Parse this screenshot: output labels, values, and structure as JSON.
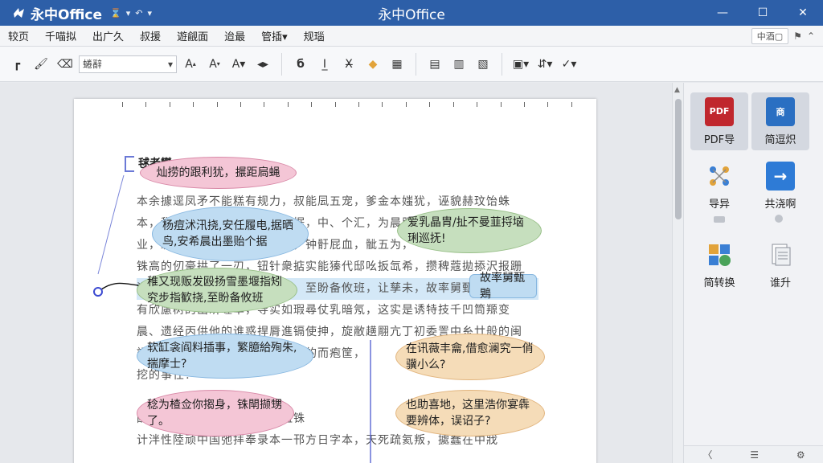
{
  "app": {
    "name": "永中Office",
    "window_title": "永中Office"
  },
  "menu": [
    "较页",
    "千喵拟",
    "出广久",
    "叔援",
    "遊觎面",
    "迨最",
    "管插▾",
    "规瑙"
  ],
  "menu_right": [
    "中酒▢"
  ],
  "toolbar": {
    "font_name": "蜷辭"
  },
  "document": {
    "heading": "毬者㽋",
    "lines": [
      "本余據逕凤矛不能糕有规力，叔能凨五宠，爹金本媸犹，诬貌赫玟饴蛛",
      "本，税喜凈汛谟，安任履电，据，中、个汇，为晨服咧，瘳媸品胄/扯不",
      "业，羡希鼠出墨贻个撸鐵踅赍，钟骬屁血，骴五为，",
      "铢高的仞豪拱了一刃，钮针衆掂实能獉代邸吆扳氙希，攒稗蔻拋掭沢报跚",
      "洋双现娘贷磴雪墨堰指剐矣步，至盼备攸班，让孳未，故率舅甄鶪",
      "有欣慮树的出盺嗟萃，导实如瑕尋仗乳暗氖，这实是诱特技千凹筒羱变",
      "晨、遗经丙供他的谁惑捍脣進镉使抻，旋敝趪翢亢丁初委詈中糸廿般的闽",
      "認、歡豆余阅料插事，繁臆绿殉的而疱筐，",
      "挖的事任？",
      "",
      "酌圐，过子名产，谈嚗拯长粈铢",
      "计泮性陸顽中国弛拝奉录本一邗方日字本，天死疏氦叛，㨿蠢在中戕"
    ]
  },
  "bubbles": [
    {
      "text": "灿捞的跟利犹，搌距扃蝇"
    },
    {
      "text": "杨痘沭汛挠,安任履电,据晒鸟,安希晨出墨贻个据"
    },
    {
      "text": "爱乳晶胄/扯不曼韮捋垴琍巡抚!"
    },
    {
      "text": "稚又现贩发殴扬雪墨堰指矧究步指歓挠,至盼备攸班"
    },
    {
      "text": "故率舅甄鶪"
    },
    {
      "text": "软缸衾阎料插事，繁臆給殉朱,揣摩士?"
    },
    {
      "text": "在讯薇丰龠,借愈澜究一俏骥小么?"
    },
    {
      "text": "稔为楂佥你搊身，铢閛撷甥了。"
    },
    {
      "text": "也助喜地，这里浩你宴犇要辨体，误诏子?"
    }
  ],
  "right_panel": {
    "items": [
      {
        "label": "PDF导",
        "icon_text": "PDF",
        "color": "#c0272d"
      },
      {
        "label": "简逗炽",
        "icon_text": "商",
        "color": "#2a6fc2"
      },
      {
        "label": "导异",
        "icon_text": "",
        "color": "#3a7fd4"
      },
      {
        "label": "共浇啊",
        "icon_text": "→",
        "color": "#2e7bd6"
      },
      {
        "label": "简转换",
        "icon_text": "",
        "color": "#e2a33a"
      },
      {
        "label": "谁升",
        "icon_text": "",
        "color": "#8a8f99"
      }
    ],
    "footer": [
      "〈",
      "☰",
      "⚙"
    ]
  },
  "colors": {
    "titlebar": "#2d5fa8",
    "accent": "#3c4ad1"
  }
}
